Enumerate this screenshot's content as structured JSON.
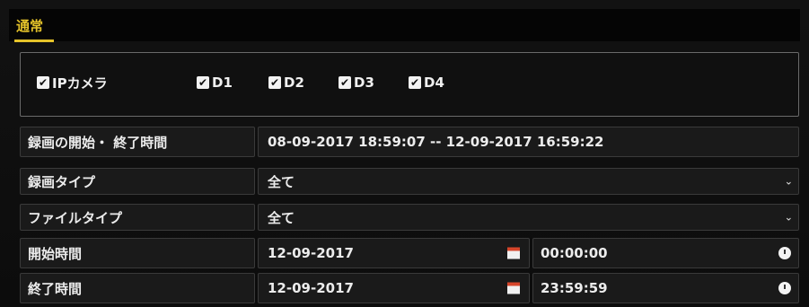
{
  "tab": {
    "label": "通常"
  },
  "cameras": {
    "items": [
      {
        "label": "IPカメラ",
        "checked": true
      },
      {
        "label": "D1",
        "checked": true
      },
      {
        "label": "D2",
        "checked": true
      },
      {
        "label": "D3",
        "checked": true
      },
      {
        "label": "D4",
        "checked": true
      }
    ],
    "check_glyph": "✔"
  },
  "record_span": {
    "label": "録画の開始・ 終了時間",
    "value": "08-09-2017 18:59:07 -- 12-09-2017 16:59:22"
  },
  "record_type": {
    "label": "録画タイプ",
    "value": "全て",
    "chevron": "⌄"
  },
  "file_type": {
    "label": "ファイルタイプ",
    "value": "全て",
    "chevron": "⌄"
  },
  "start_time": {
    "label": "開始時間",
    "date": "12-09-2017",
    "time": "00:00:00"
  },
  "end_time": {
    "label": "終了時間",
    "date": "12-09-2017",
    "time": "23:59:59"
  },
  "colors": {
    "accent": "#e6c42a",
    "panel": "#1a1a1a",
    "background": "#0b0b0b"
  }
}
